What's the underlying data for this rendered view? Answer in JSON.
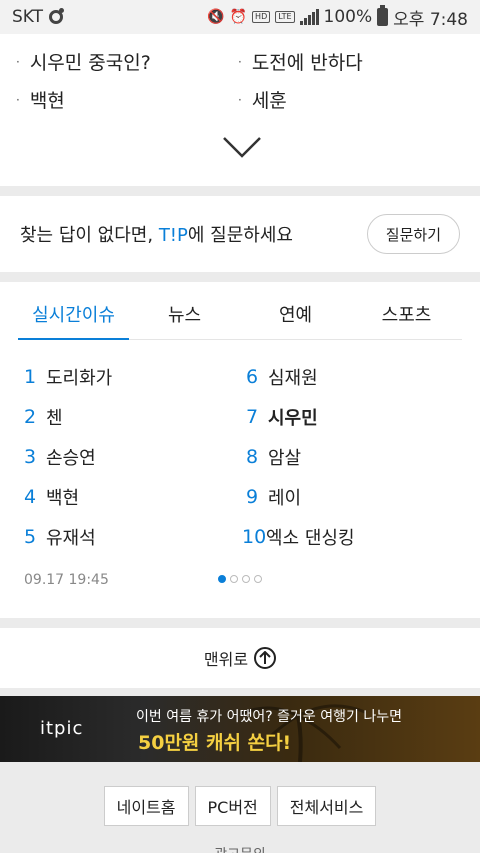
{
  "status_bar": {
    "carrier": "SKT",
    "hd_label": "HD",
    "hd_sub": "Voice",
    "lte_label": "LTE",
    "battery": "100%",
    "time": "오후 7:48"
  },
  "related": {
    "items": [
      "시우민 중국인?",
      "도전에 반하다",
      "백현",
      "세훈"
    ]
  },
  "ask": {
    "prefix": "찾는 답이 없다면, ",
    "tip": "T!P",
    "suffix": "에 질문하세요",
    "button": "질문하기"
  },
  "realtime": {
    "tabs": [
      "실시간이슈",
      "뉴스",
      "연예",
      "스포츠"
    ],
    "ranks": [
      {
        "num": "1",
        "text": "도리화가"
      },
      {
        "num": "2",
        "text": "첸"
      },
      {
        "num": "3",
        "text": "손승연"
      },
      {
        "num": "4",
        "text": "백현"
      },
      {
        "num": "5",
        "text": "유재석"
      },
      {
        "num": "6",
        "text": "심재원"
      },
      {
        "num": "7",
        "text": "시우민"
      },
      {
        "num": "8",
        "text": "암살"
      },
      {
        "num": "9",
        "text": "레이"
      },
      {
        "num": "10",
        "text": "엑소 댄싱킹"
      }
    ],
    "timestamp": "09.17 19:45",
    "page_active": 1,
    "page_count": 4
  },
  "totop": {
    "label": "맨위로"
  },
  "ad": {
    "logo": "itpic",
    "line1": "이번 여름 휴가 어땠어? 즐거운 여행기 나누면",
    "line2": "50만원 캐쉬 쏜다!"
  },
  "footer": {
    "buttons": [
      "네이트홈",
      "PC버전",
      "전체서비스"
    ],
    "ad_text": "광고문의"
  },
  "colors": {
    "accent": "#0a7fd8",
    "background": "#ebebeb"
  }
}
